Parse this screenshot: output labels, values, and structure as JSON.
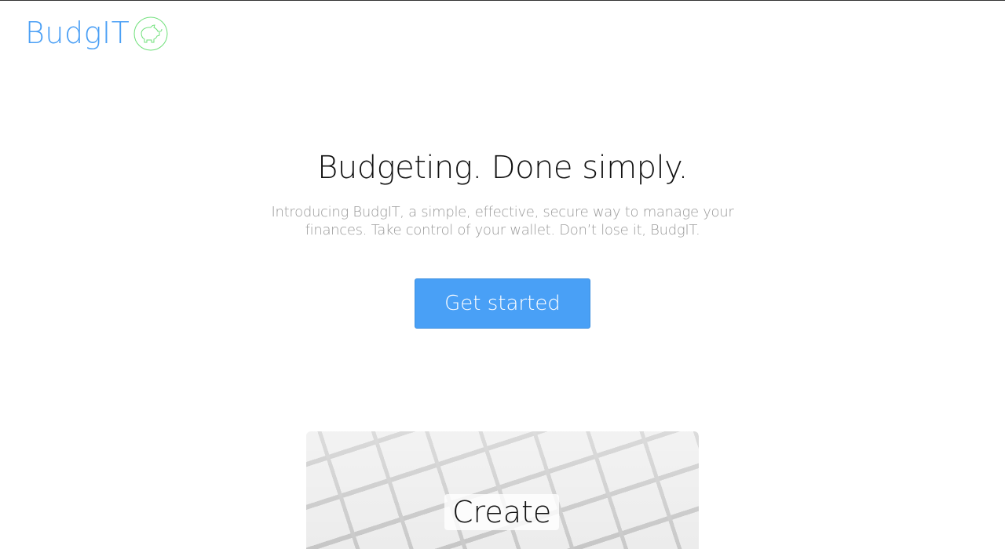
{
  "brand": {
    "name": "BudgIT",
    "icon": "piggy-bank-icon",
    "color": "#4a9ff5",
    "icon_color": "#6fe07a"
  },
  "hero": {
    "title": "Budgeting. Done simply.",
    "subtitle": "Introducing BudgIT, a simple, effective, secure way to manage your finances. Take control of your wallet. Don’t lose it, BudgIT.",
    "cta_label": "Get started",
    "cta_color": "#49a0f6"
  },
  "cards": [
    {
      "label": "Create"
    }
  ]
}
